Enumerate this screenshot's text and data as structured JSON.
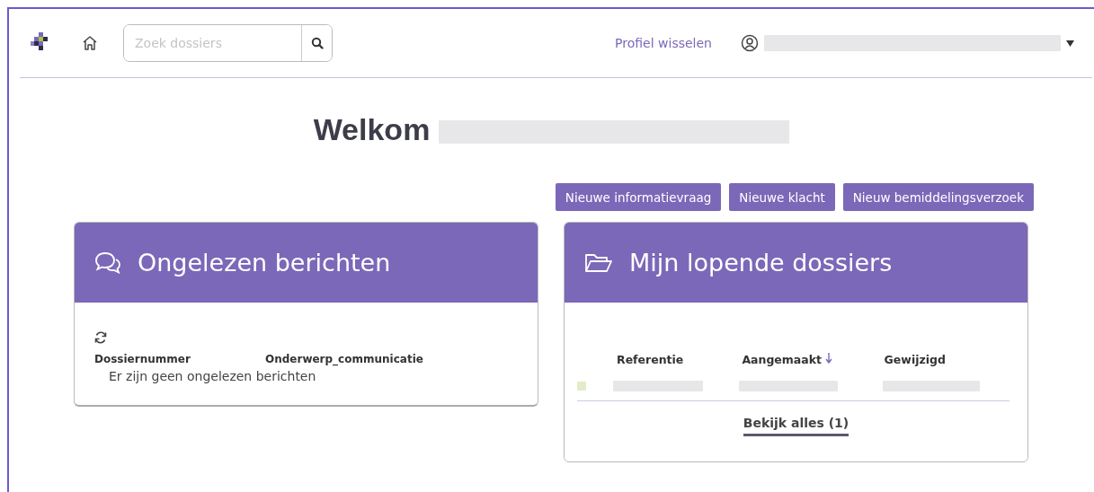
{
  "header": {
    "search": {
      "placeholder": "Zoek dossiers"
    },
    "switch_profile": "Profiel wisselen"
  },
  "welcome": {
    "title": "Welkom"
  },
  "actions": [
    "Nieuwe informatievraag",
    "Nieuwe klacht",
    "Nieuw bemiddelingsverzoek"
  ],
  "unread": {
    "title": "Ongelezen berichten",
    "columns": [
      "Dossiernummer",
      "Onderwerp_communicatie"
    ],
    "empty_message": "Er zijn geen ongelezen berichten"
  },
  "cases": {
    "title": "Mijn lopende dossiers",
    "columns": [
      {
        "label": "Referentie",
        "sorted": false
      },
      {
        "label": "Aangemaakt",
        "sorted": true
      },
      {
        "label": "Gewijzigd",
        "sorted": false
      }
    ],
    "view_all": "Bekijk alles (1)"
  }
}
